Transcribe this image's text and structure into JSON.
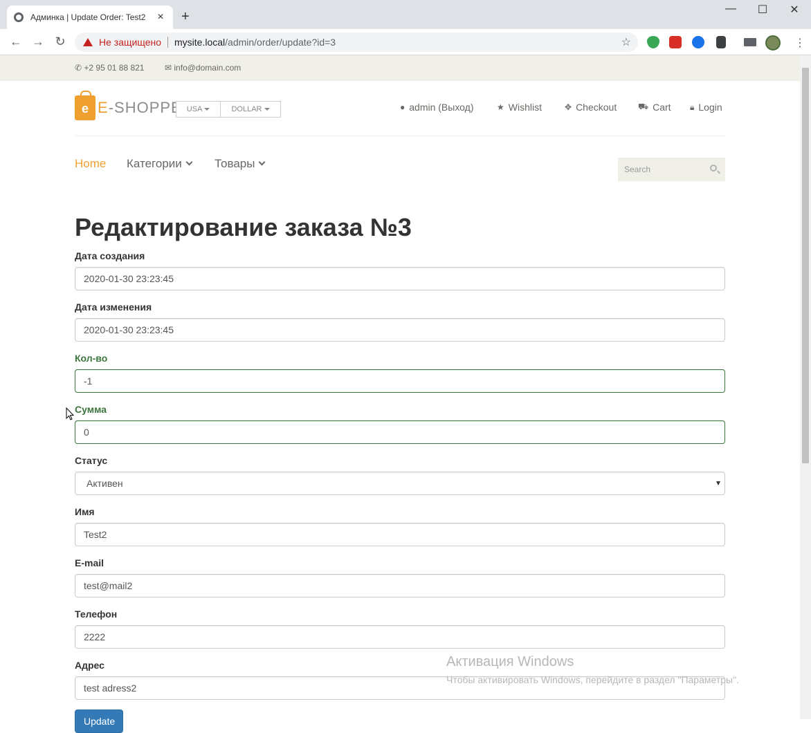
{
  "browser": {
    "tab_title": "Админка | Update Order: Test2",
    "tab_close": "×",
    "new_tab": "+",
    "window_min": "—",
    "window_max": "☐",
    "window_close": "✕",
    "back": "←",
    "forward": "→",
    "reload": "↻",
    "security_label": "Не защищено",
    "url_host": "mysite.local",
    "url_path": "/admin/order/update?id=3",
    "bookmark": "☆",
    "menu": "⋮"
  },
  "header_top": {
    "phone": "+2 95 01 88 821",
    "email": "info@domain.com"
  },
  "logo": {
    "letter": "e",
    "text_e": "E",
    "text_rest": "-SHOPPER"
  },
  "dropdowns": {
    "country": "USA",
    "currency": "DOLLAR"
  },
  "shop_menu": {
    "account": "admin (Выход)",
    "wishlist": "Wishlist",
    "checkout": "Checkout",
    "cart": "Cart",
    "login": "Login"
  },
  "main_nav": {
    "home": "Home",
    "categories": "Категории",
    "products": "Товары"
  },
  "search": {
    "placeholder": "Search"
  },
  "form": {
    "title": "Редактирование заказа №3",
    "created_label": "Дата создания",
    "created_value": "2020-01-30 23:23:45",
    "updated_label": "Дата изменения",
    "updated_value": "2020-01-30 23:23:45",
    "qty_label": "Кол-во",
    "qty_value": "-1",
    "sum_label": "Сумма",
    "sum_value": "0",
    "status_label": "Статус",
    "status_value": "Активен",
    "name_label": "Имя",
    "name_value": "Test2",
    "email_label": "E-mail",
    "email_value": "test@mail2",
    "phone_label": "Телефон",
    "phone_value": "2222",
    "address_label": "Адрес",
    "address_value": "test adress2",
    "submit_label": "Update"
  },
  "watermark": {
    "line1": "Активация Windows",
    "line2": "Чтобы активировать Windows, перейдите в раздел \"Параметры\"."
  },
  "colors": {
    "accent": "#f0a02f",
    "success": "#3c763d",
    "primary": "#337ab7",
    "insecure": "#c5221f"
  }
}
